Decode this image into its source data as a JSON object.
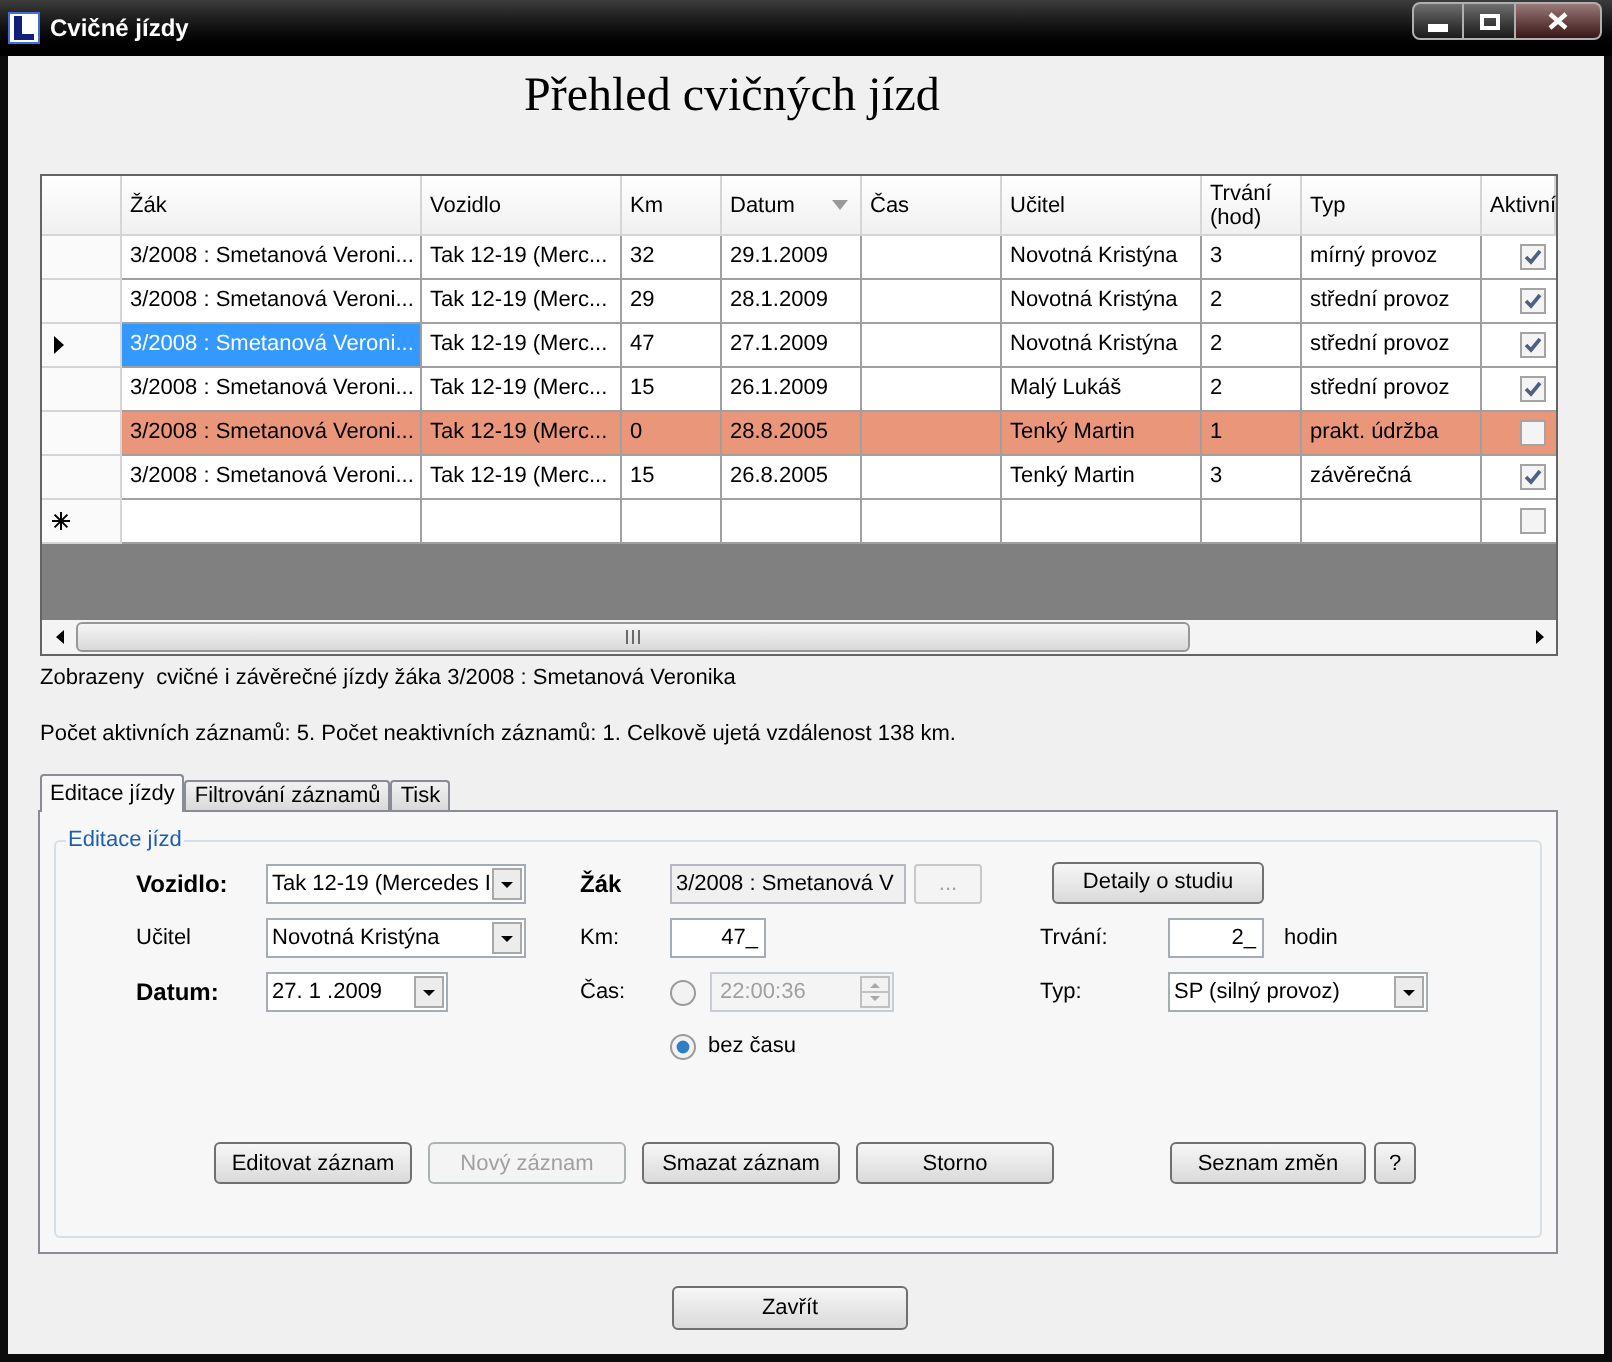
{
  "window": {
    "title": "Cvičné jízdy"
  },
  "heading": "Přehled cvičných jízd",
  "grid": {
    "columns": [
      {
        "label": "Žák",
        "sorted": false
      },
      {
        "label": "Vozidlo",
        "sorted": false
      },
      {
        "label": "Km",
        "sorted": false
      },
      {
        "label": "Datum",
        "sorted": true
      },
      {
        "label": "Čas",
        "sorted": false
      },
      {
        "label": "Učitel",
        "sorted": false
      },
      {
        "label": "Trvání (hod)",
        "sorted": false
      },
      {
        "label": "Typ",
        "sorted": false
      },
      {
        "label": "Aktivní",
        "sorted": false
      }
    ],
    "rows": [
      {
        "cells": [
          "3/2008 : Smetanová Veroni...",
          "Tak 12-19 (Merc...",
          "32",
          "29.1.2009",
          null,
          "Novotná Kristýna",
          "3",
          "mírný provoz"
        ],
        "active": true,
        "selected": false
      },
      {
        "cells": [
          "3/2008 : Smetanová Veroni...",
          "Tak 12-19 (Merc...",
          "29",
          "28.1.2009",
          null,
          "Novotná Kristýna",
          "2",
          "střední provoz"
        ],
        "active": true,
        "selected": false
      },
      {
        "cells": [
          "3/2008 : Smetanová Veroni...",
          "Tak 12-19 (Merc...",
          "47",
          "27.1.2009",
          null,
          "Novotná Kristýna",
          "2",
          "střední provoz"
        ],
        "active": true,
        "selected": true
      },
      {
        "cells": [
          "3/2008 : Smetanová Veroni...",
          "Tak 12-19 (Merc...",
          "15",
          "26.1.2009",
          null,
          "Malý Lukáš",
          "2",
          "střední provoz"
        ],
        "active": true,
        "selected": false
      },
      {
        "cells": [
          "3/2008 : Smetanová Veroni...",
          "Tak 12-19 (Merc...",
          "0",
          "28.8.2005",
          null,
          "Tenký Martin",
          "1",
          "prakt. údržba"
        ],
        "active": false,
        "selected": false
      },
      {
        "cells": [
          "3/2008 : Smetanová Veroni...",
          "Tak 12-19 (Merc...",
          "15",
          "26.8.2005",
          null,
          "Tenký Martin",
          "3",
          "závěrečná"
        ],
        "active": true,
        "selected": false
      }
    ],
    "new_row": {
      "active": false
    }
  },
  "status_lines": [
    "Zobrazeny  cvičné i závěrečné jízdy žáka 3/2008 : Smetanová Veronika",
    "Počet aktivních záznamů: 5. Počet neaktivních záznamů: 1. Celkově ujetá vzdálenost 138 km."
  ],
  "tabs": [
    {
      "label": "Editace jízdy",
      "selected": true
    },
    {
      "label": "Filtrování záznamů",
      "selected": false
    },
    {
      "label": "Tisk",
      "selected": false
    }
  ],
  "form": {
    "legend": "Editace jízd",
    "vehicle": {
      "label": "Vozidlo:",
      "emphasized": true,
      "value": "Tak 12-19 (Mercedes I"
    },
    "teacher": {
      "label": "Učitel",
      "emphasized": false,
      "value": "Novotná Kristýna"
    },
    "date": {
      "label": "Datum:",
      "emphasized": true,
      "value": "27. 1 .2009"
    },
    "student": {
      "label": "Žák",
      "emphasized": true,
      "value": "3/2008 : Smetanová V",
      "read_only": true,
      "browse": {
        "label": "...",
        "disabled": true
      }
    },
    "km": {
      "label": "Km:",
      "emphasized": false,
      "value": "47_"
    },
    "time": {
      "label": "Čas:",
      "emphasized": false,
      "value": "22:00:36",
      "selected": false
    },
    "no_time": {
      "label": "bez času",
      "selected": true
    },
    "details_button": "Detaily o studiu",
    "duration": {
      "label": "Trvání:",
      "value": "2_",
      "unit": "hodin"
    },
    "type": {
      "label": "Typ:",
      "value": "SP (silný provoz)"
    },
    "actions": [
      {
        "label": "Editovat záznam",
        "disabled": false
      },
      {
        "label": "Nový záznam",
        "disabled": true
      },
      {
        "label": "Smazat záznam",
        "disabled": false
      },
      {
        "label": "Storno",
        "disabled": false
      }
    ],
    "history_actions": [
      {
        "label": "Seznam změn",
        "disabled": false
      },
      {
        "label": "?",
        "disabled": false
      }
    ]
  },
  "close_button": "Zavřít"
}
